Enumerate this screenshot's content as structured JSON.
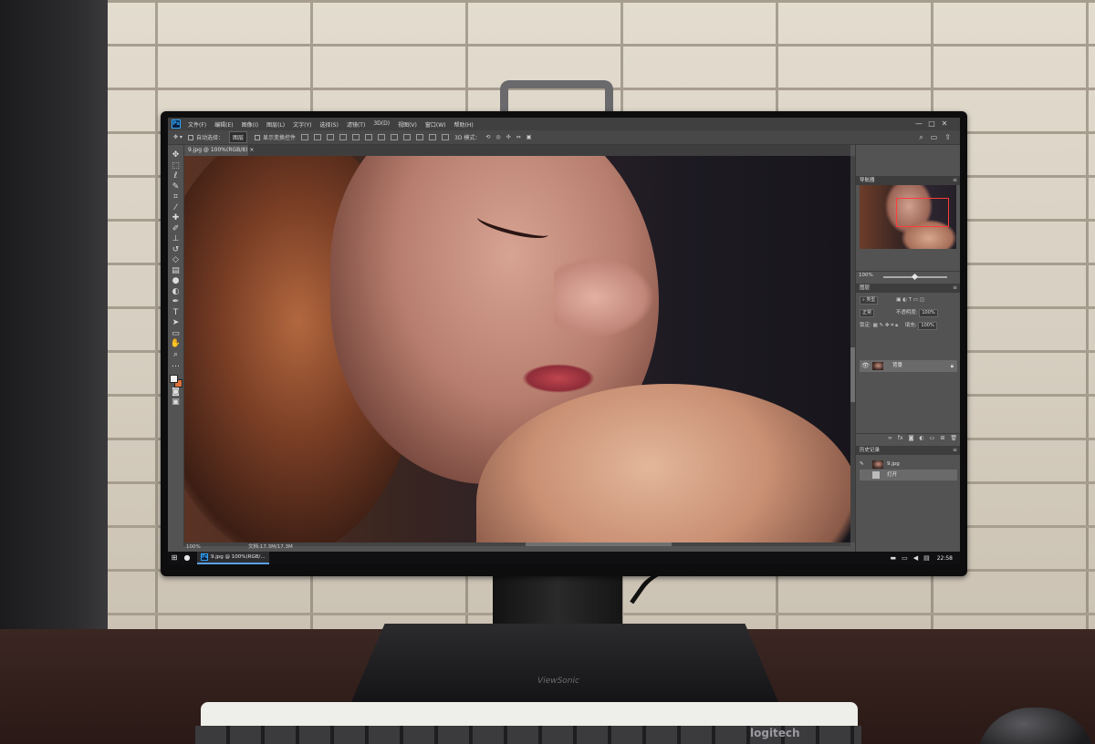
{
  "app": {
    "logo": "Ps",
    "menu": [
      "文件(F)",
      "编辑(E)",
      "图像(I)",
      "图层(L)",
      "文字(Y)",
      "选择(S)",
      "滤镜(T)",
      "3D(D)",
      "视图(V)",
      "窗口(W)",
      "帮助(H)"
    ],
    "window_controls": [
      "—",
      "□",
      "✕"
    ]
  },
  "options_bar": {
    "auto_select_label": "自动选择：",
    "auto_select_value": "图层",
    "transform_controls_label": "显示变换控件",
    "mode_3d_label": "3D 模式："
  },
  "document": {
    "tab_label": "9.jpg @ 100%(RGB/8)",
    "zoom": "100%",
    "doc_info": "文档:17.3M/17.3M"
  },
  "panels": {
    "navigator": {
      "title": "导航器",
      "zoom": "100%"
    },
    "layers": {
      "title": "图层",
      "filter_label": "类型",
      "blend_mode": "正常",
      "opacity_label": "不透明度:",
      "opacity_value": "100%",
      "lock_label": "锁定:",
      "fill_label": "填充:",
      "fill_value": "100%",
      "layer_name": "背景"
    },
    "history": {
      "title": "历史记录",
      "snapshot": "9.jpg",
      "step": "打开"
    }
  },
  "taskbar": {
    "task_label": "9.jpg @ 100%(RGB/...",
    "time": "22:58"
  },
  "hardware": {
    "keyboard_brand": "logitech",
    "monitor_brand": "ViewSonic"
  },
  "colors": {
    "foreground": "#f2f2f2",
    "background": "#e0703a",
    "nav_view_box": "#ff3b3b"
  }
}
